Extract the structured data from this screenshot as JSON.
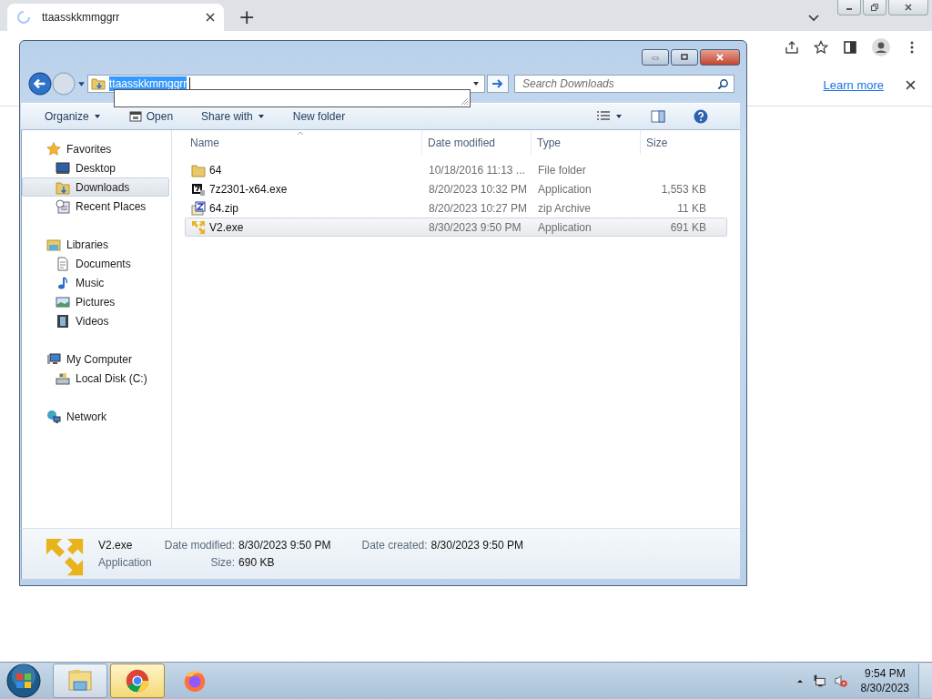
{
  "browser": {
    "tab": {
      "title": "ttaasskkmmggrr",
      "loading": true
    },
    "new_tab": "+",
    "infobar": {
      "link": "Learn more"
    }
  },
  "explorer": {
    "address": {
      "value": "ttaasskkmmggrr",
      "selected": true
    },
    "search": {
      "placeholder": "Search Downloads"
    },
    "commands": [
      {
        "label": "Organize",
        "menu": true,
        "kind": "plain"
      },
      {
        "label": "Open",
        "menu": false,
        "kind": "open"
      },
      {
        "label": "Share with",
        "menu": true,
        "kind": "plain"
      },
      {
        "label": "New folder",
        "menu": false,
        "kind": "plain"
      }
    ],
    "nav": [
      {
        "label": "Favorites",
        "kind": "star",
        "children": [
          {
            "label": "Desktop",
            "kind": "desktop",
            "selected": false
          },
          {
            "label": "Downloads",
            "kind": "downloads",
            "selected": true
          },
          {
            "label": "Recent Places",
            "kind": "recent",
            "selected": false
          }
        ]
      },
      {
        "label": "Libraries",
        "kind": "library",
        "children": [
          {
            "label": "Documents",
            "kind": "document",
            "selected": false
          },
          {
            "label": "Music",
            "kind": "music",
            "selected": false
          },
          {
            "label": "Pictures",
            "kind": "pictures",
            "selected": false
          },
          {
            "label": "Videos",
            "kind": "videos",
            "selected": false
          }
        ]
      },
      {
        "label": "My Computer",
        "kind": "computer",
        "children": [
          {
            "label": "Local Disk (C:)",
            "kind": "disk",
            "selected": false
          }
        ]
      },
      {
        "label": "Network",
        "kind": "network"
      }
    ],
    "columns": [
      "Name",
      "Date modified",
      "Type",
      "Size"
    ],
    "files": [
      {
        "name": "64",
        "date": "10/18/2016 11:13 ...",
        "type": "File folder",
        "kind": "folder",
        "selected": false
      },
      {
        "name": "7z2301-x64.exe",
        "date": "8/20/2023 10:32 PM",
        "type": "Application",
        "size": "1,553 KB",
        "kind": "sevenzip",
        "selected": false
      },
      {
        "name": "64.zip",
        "date": "8/20/2023 10:27 PM",
        "type": "zip Archive",
        "size": "11 KB",
        "kind": "zip",
        "selected": false
      },
      {
        "name": "V2.exe",
        "date": "8/30/2023 9:50 PM",
        "type": "Application",
        "size": "691 KB",
        "kind": "arrows",
        "selected": true
      }
    ],
    "details": {
      "name": "V2.exe",
      "type": "Application",
      "fields": [
        {
          "label": "Date modified:",
          "value": "8/30/2023 9:50 PM"
        },
        {
          "label": "Size:",
          "value": "690 KB"
        },
        {
          "label": "Date created:",
          "value": "8/30/2023 9:50 PM"
        }
      ]
    }
  },
  "taskbar": {
    "apps": [
      {
        "kind": "explorer",
        "running": true,
        "selected": false
      },
      {
        "kind": "chrome",
        "running": true,
        "selected": true
      },
      {
        "kind": "firefox",
        "running": false,
        "selected": false
      }
    ],
    "clock": {
      "time": "9:54 PM",
      "date": "8/30/2023"
    }
  }
}
